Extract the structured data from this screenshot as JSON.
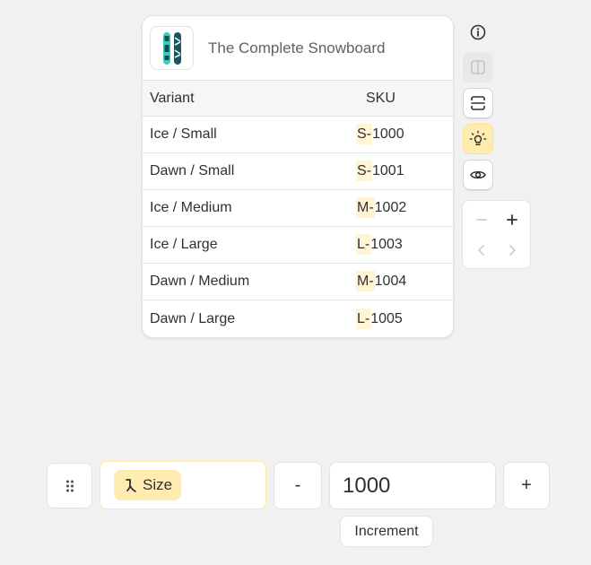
{
  "product": {
    "title": "The Complete Snowboard",
    "thumbnail_icon": "snowboard-image"
  },
  "table": {
    "headers": {
      "variant": "Variant",
      "sku": "SKU"
    },
    "rows": [
      {
        "variant": "Ice / Small",
        "sku_prefix": "S-",
        "sku_number": "1000"
      },
      {
        "variant": "Dawn / Small",
        "sku_prefix": "S-",
        "sku_number": "1001"
      },
      {
        "variant": "Ice / Medium",
        "sku_prefix": "M-",
        "sku_number": "1002"
      },
      {
        "variant": "Ice / Large",
        "sku_prefix": "L-",
        "sku_number": "1003"
      },
      {
        "variant": "Dawn / Medium",
        "sku_prefix": "M-",
        "sku_number": "1004"
      },
      {
        "variant": "Dawn / Large",
        "sku_prefix": "L-",
        "sku_number": "1005"
      }
    ]
  },
  "toolbar": {
    "icons": [
      "info-icon",
      "split-view-icon",
      "barcode-scan-icon",
      "lightbulb-icon",
      "eye-icon"
    ],
    "pager": {
      "icons": [
        "minus-icon",
        "plus-icon",
        "chevron-left-icon",
        "chevron-right-icon"
      ]
    }
  },
  "controls": {
    "drag_icon": "drag-handle-icon",
    "field_chip": "Size",
    "field_icon": "merge-icon",
    "minus_label": "-",
    "value": "1000",
    "plus_label": "+",
    "increment_label": "Increment"
  },
  "colors": {
    "highlight": "#fff4d3",
    "accent": "#ffecb0",
    "border": "#e3e3e3",
    "background": "#f1f1f1"
  }
}
